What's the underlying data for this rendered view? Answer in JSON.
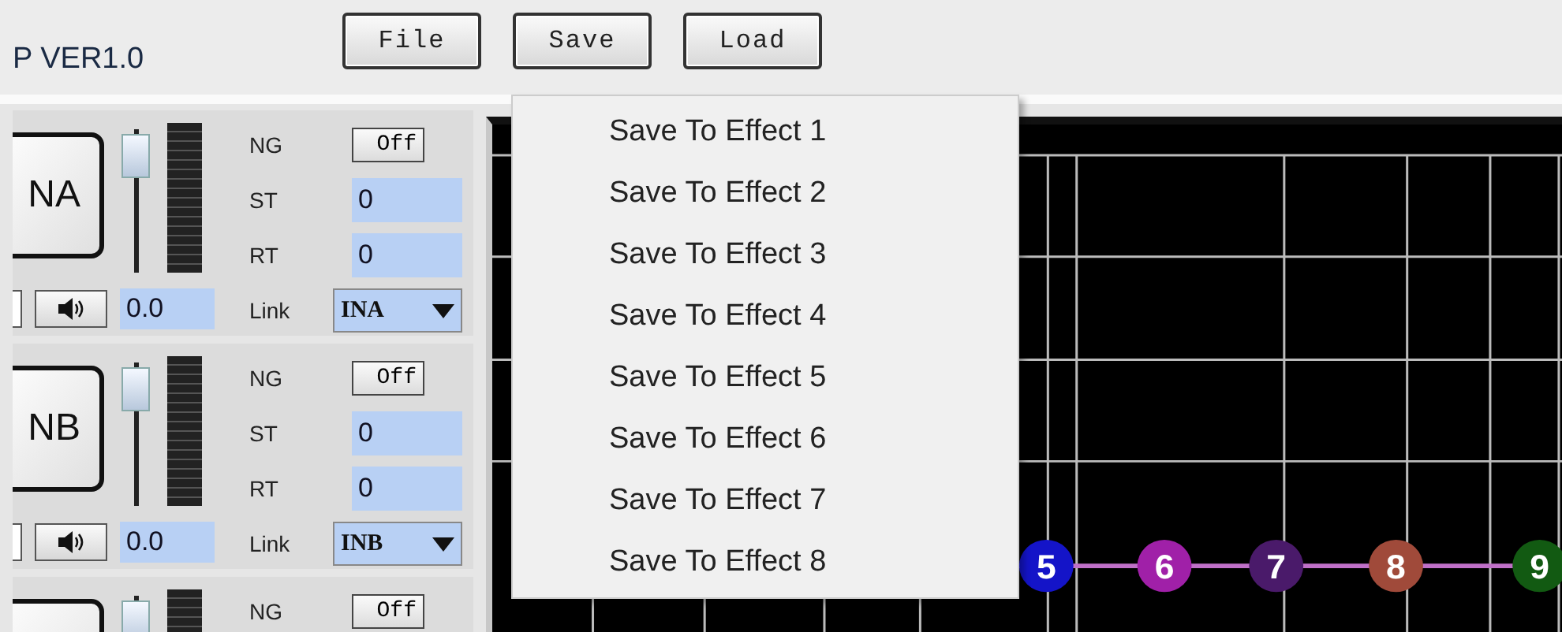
{
  "header": {
    "title": "P VER1.0",
    "buttons": [
      "File",
      "Save",
      "Load"
    ]
  },
  "channels": [
    {
      "name": "NA",
      "fader": {
        "level": 0.9
      },
      "checked": false,
      "gain": "0.0",
      "ng_label": "NG",
      "ng": "Off",
      "st_label": "ST",
      "st": "0",
      "rt_label": "RT",
      "rt": "0",
      "link_label": "Link",
      "link": "INA"
    },
    {
      "name": "NB",
      "fader": {
        "level": 0.9
      },
      "checked": false,
      "gain": "0.0",
      "ng_label": "NG",
      "ng": "Off",
      "st_label": "ST",
      "st": "0",
      "rt_label": "RT",
      "rt": "0",
      "link_label": "Link",
      "link": "INB"
    },
    {
      "fader": {
        "level": 0.9
      },
      "ng_label": "NG",
      "ng": "Off"
    }
  ],
  "graph": {
    "nodes": [
      {
        "label": "5",
        "color": "#1414c8"
      },
      {
        "label": "6",
        "color": "#a020a8"
      },
      {
        "label": "7",
        "color": "#4a1a6a"
      },
      {
        "label": "8",
        "color": "#a04a3a"
      },
      {
        "label": "9",
        "color": "#125a12"
      }
    ]
  },
  "save_menu": {
    "items": [
      "Save To Effect 1",
      "Save To Effect 2",
      "Save To Effect 3",
      "Save To Effect 4",
      "Save To Effect 5",
      "Save To Effect 6",
      "Save To Effect 7",
      "Save To Effect 8"
    ]
  }
}
